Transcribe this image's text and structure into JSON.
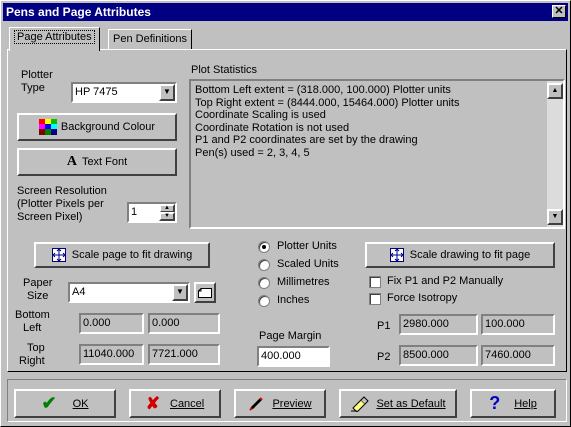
{
  "window": {
    "title": "Pens and Page Attributes",
    "close_glyph": "✕"
  },
  "tabs": [
    {
      "label": "Page Attributes"
    },
    {
      "label": "Pen Definitions"
    }
  ],
  "plotter": {
    "label_line1": "Plotter",
    "label_line2": "Type",
    "value": "HP 7475",
    "dropdown_glyph": "▼"
  },
  "background_colour": {
    "label": "Background Colour"
  },
  "text_font": {
    "label": "Text Font",
    "glyph": "A"
  },
  "resolution": {
    "line1": "Screen Resolution",
    "line2": "(Plotter Pixels per",
    "line3": "Screen Pixel)",
    "value": "1"
  },
  "stats": {
    "title": "Plot Statistics",
    "lines": [
      "Bottom Left extent = (318.000, 100.000) Plotter units",
      "Top Right extent = (8444.000, 15464.000) Plotter units",
      "Coordinate Scaling is used",
      "Coordinate Rotation is not used",
      "P1 and P2 coordinates are set by the drawing",
      "Pen(s) used = 2, 3, 4, 5"
    ]
  },
  "scale_page_btn": {
    "label": "Scale page to fit drawing"
  },
  "scale_drawing_btn": {
    "label": "Scale drawing to fit page"
  },
  "units": {
    "options": [
      "Plotter Units",
      "Scaled Units",
      "Millimetres",
      "Inches"
    ],
    "selected": "Plotter Units"
  },
  "paper": {
    "label_line1": "Paper",
    "label_line2": "Size",
    "value": "A4"
  },
  "fix_p1p2": {
    "label": "Fix P1 and P2 Manually",
    "checked": false
  },
  "force_iso": {
    "label": "Force Isotropy",
    "checked": false
  },
  "bottom_left": {
    "label_line1": "Bottom",
    "label_line2": "Left",
    "x": "0.000",
    "y": "0.000"
  },
  "top_right": {
    "label_line1": "Top",
    "label_line2": "Right",
    "x": "11040.000",
    "y": "7721.000"
  },
  "margin": {
    "label": "Page Margin",
    "value": "400.000"
  },
  "p1": {
    "label": "P1",
    "x": "2980.000",
    "y": "100.000"
  },
  "p2": {
    "label": "P2",
    "x": "8500.000",
    "y": "7460.000"
  },
  "footer": {
    "ok": {
      "label": "OK",
      "icon": "✔"
    },
    "cancel": {
      "label": "Cancel",
      "icon": "✘"
    },
    "preview": {
      "label": "Preview"
    },
    "default": {
      "label": "Set as Default"
    },
    "help": {
      "label": "Help",
      "icon": "?"
    }
  }
}
